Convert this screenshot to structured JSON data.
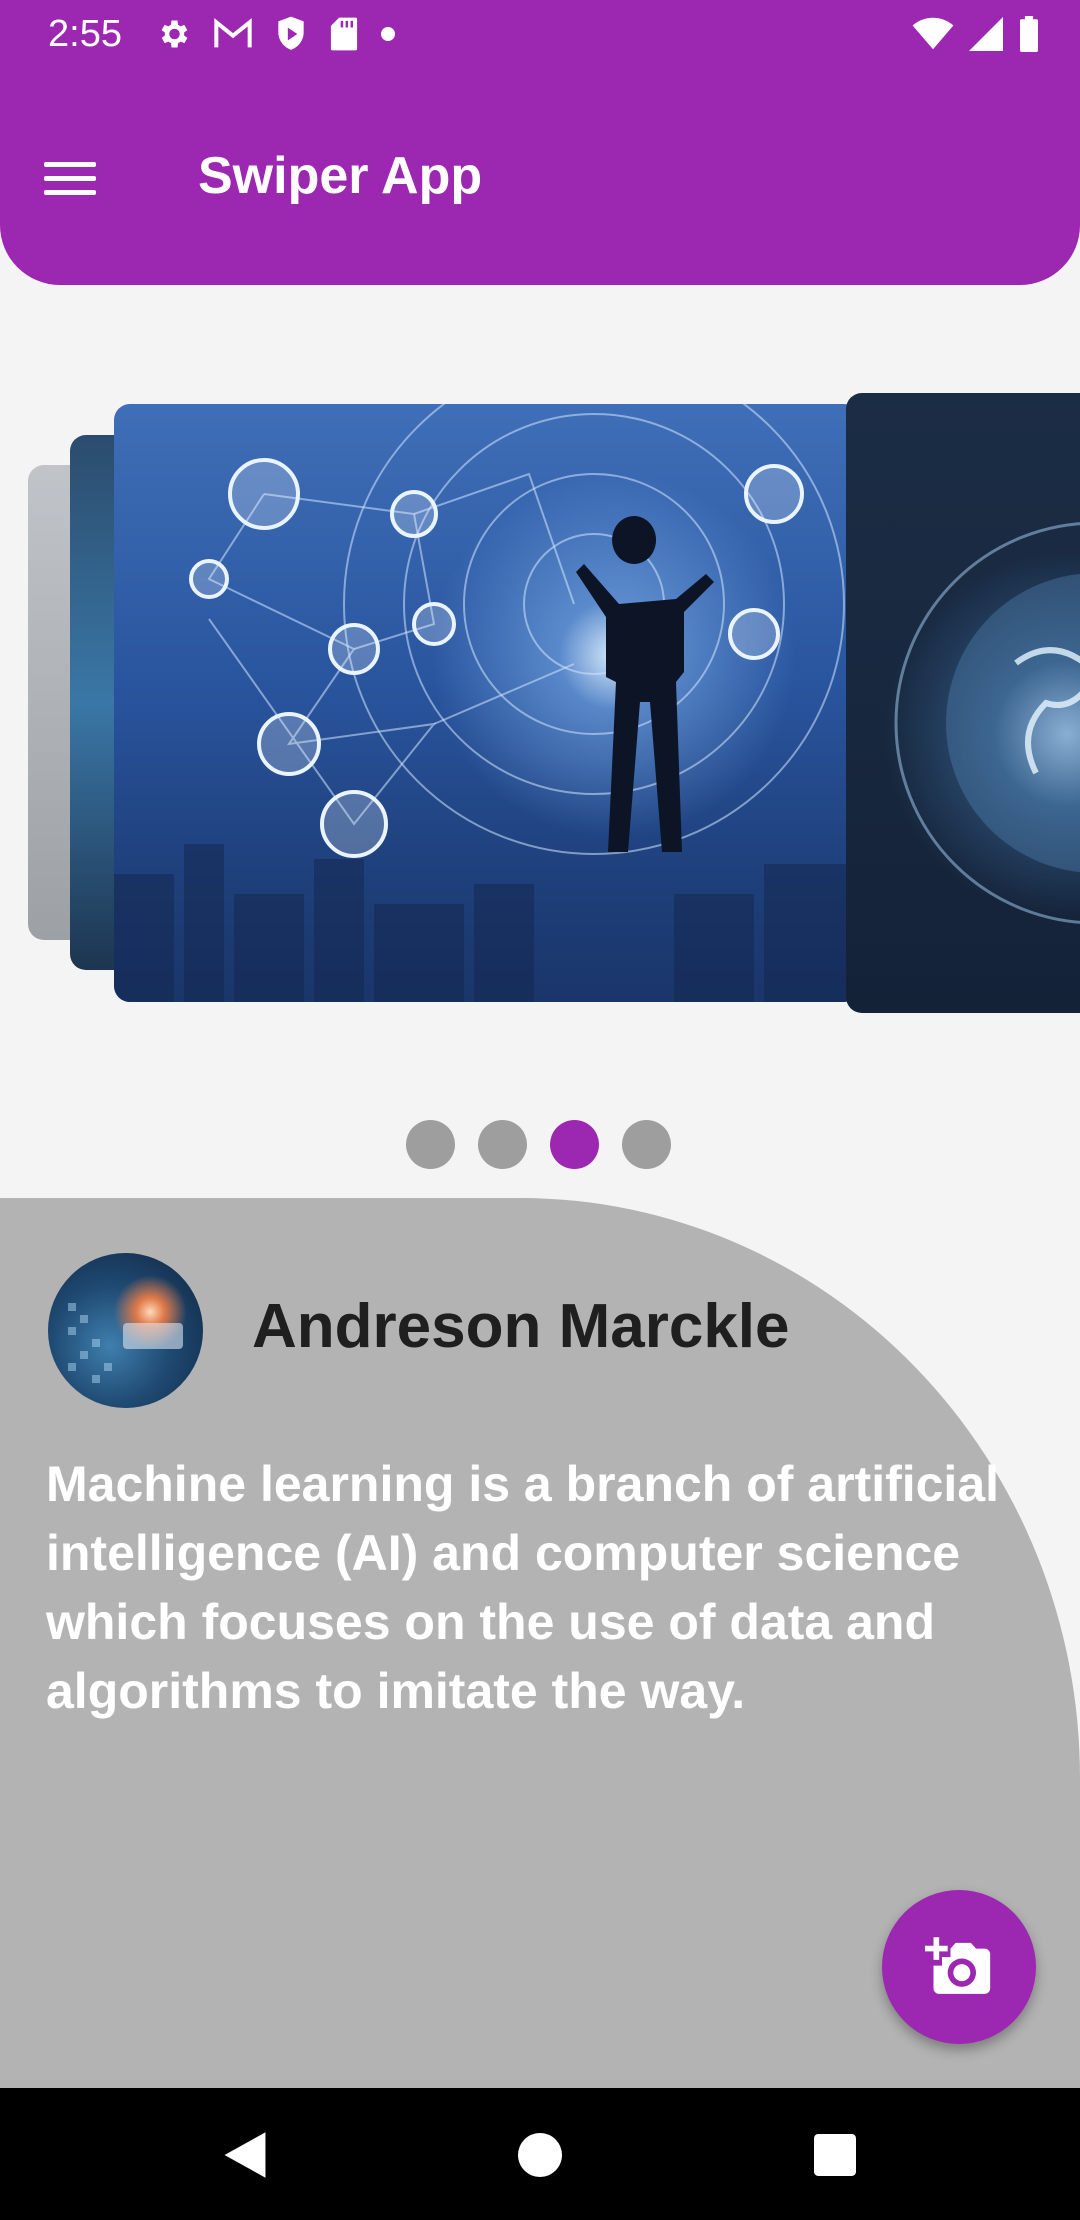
{
  "status_bar": {
    "time": "2:55",
    "left_icons": [
      "gear-icon",
      "gmail-icon",
      "shield-play-icon",
      "sd-card-icon",
      "dot-icon"
    ],
    "right_icons": [
      "wifi-icon",
      "signal-icon",
      "battery-icon"
    ]
  },
  "app_bar": {
    "title": "Swiper App",
    "menu_icon": "hamburger-menu-icon",
    "color": "#9c27b0"
  },
  "carousel": {
    "slide_count": 4,
    "active_index": 2,
    "images": [
      "tech-network-image",
      "tech-network-image-2",
      "smart-city-businessman-image",
      "digital-globe-image"
    ]
  },
  "pagination": {
    "dots": 4,
    "active": 3,
    "active_color": "#9c27b0",
    "inactive_color": "#9e9e9e"
  },
  "profile": {
    "name": "Andreson Marckle",
    "avatar": "tech-avatar-image"
  },
  "description": "Machine learning is a branch of artificial intelligence (AI) and computer science which focuses on the use of data and algorithms to imitate the way.",
  "fab": {
    "icon": "add-photo-camera-icon"
  },
  "nav_bar": {
    "buttons": [
      "back-icon",
      "home-icon",
      "recents-icon"
    ]
  }
}
